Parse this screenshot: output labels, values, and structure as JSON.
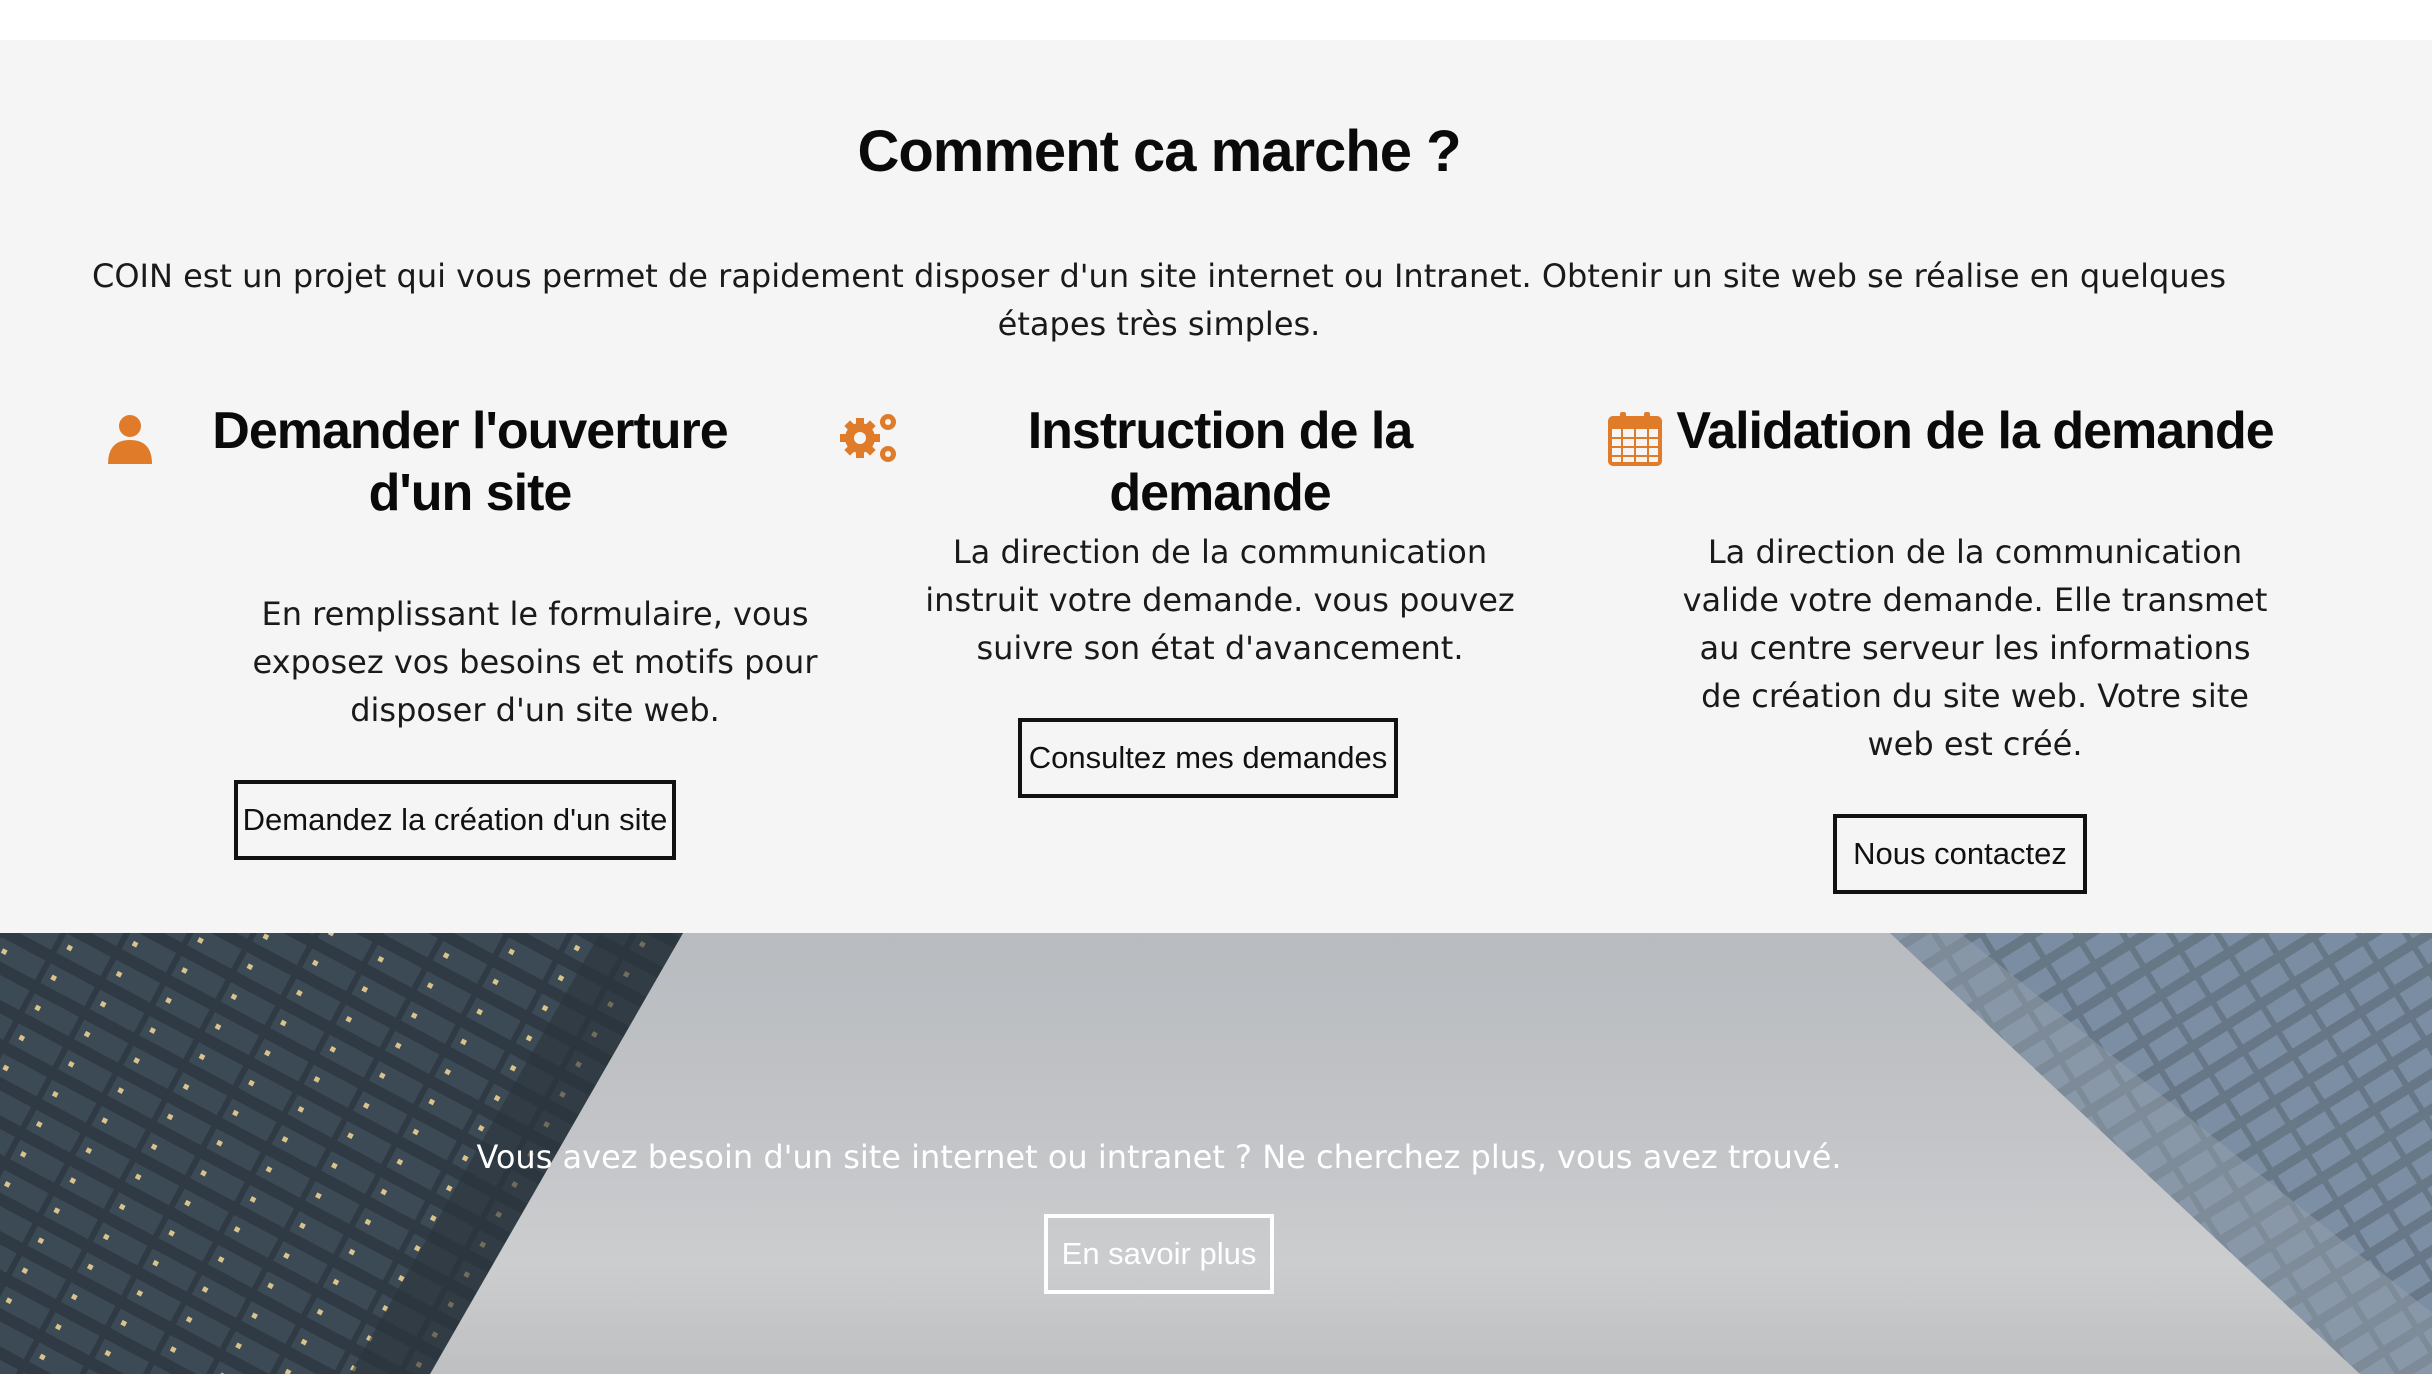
{
  "section": {
    "title": "Comment ca marche ?",
    "intro": "COIN est un projet qui vous permet de rapidement disposer d'un site internet ou Intranet. Obtenir un site web se réalise en quelques étapes très simples."
  },
  "steps": [
    {
      "icon": "user-icon",
      "title": "Demander l'ouverture d'un site",
      "text": "En remplissant le formulaire, vous exposez vos besoins et motifs pour disposer d'un site web.",
      "button": "Demandez la création d'un site"
    },
    {
      "icon": "gears-icon",
      "title": "Instruction de la demande",
      "text": "La direction de la communication instruit votre demande. vous pouvez suivre son état d'avancement.",
      "button": "Consultez mes demandes"
    },
    {
      "icon": "calendar-icon",
      "title": "Validation de la demande",
      "text": "La direction de la communication valide votre demande. Elle transmet au centre serveur les informations de création du site web. Votre site web est créé.",
      "button": "Nous contactez"
    }
  ],
  "hero": {
    "text": "Vous avez besoin d'un site internet ou intranet ? Ne cherchez plus, vous avez trouvé.",
    "button": "En savoir plus"
  },
  "colors": {
    "accent": "#e07b2a",
    "section_bg": "#f5f5f5",
    "text": "#111111"
  }
}
